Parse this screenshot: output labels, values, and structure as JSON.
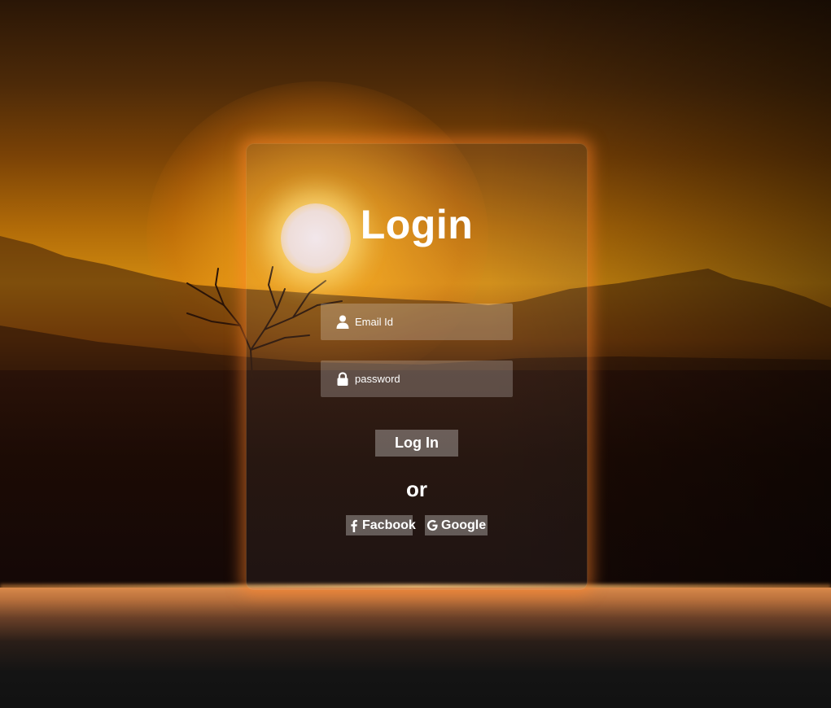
{
  "login": {
    "title": "Login",
    "email_placeholder": "Email Id",
    "password_placeholder": "password",
    "login_button": "Log In",
    "separator": "or",
    "facebook_button": "Facbook",
    "google_button": "Google"
  },
  "icons": {
    "email": "user-icon",
    "password": "lock-icon",
    "facebook": "facebook-icon",
    "google": "google-icon"
  },
  "colors": {
    "accent_glow": "#ff8228",
    "text": "#ffffff"
  }
}
